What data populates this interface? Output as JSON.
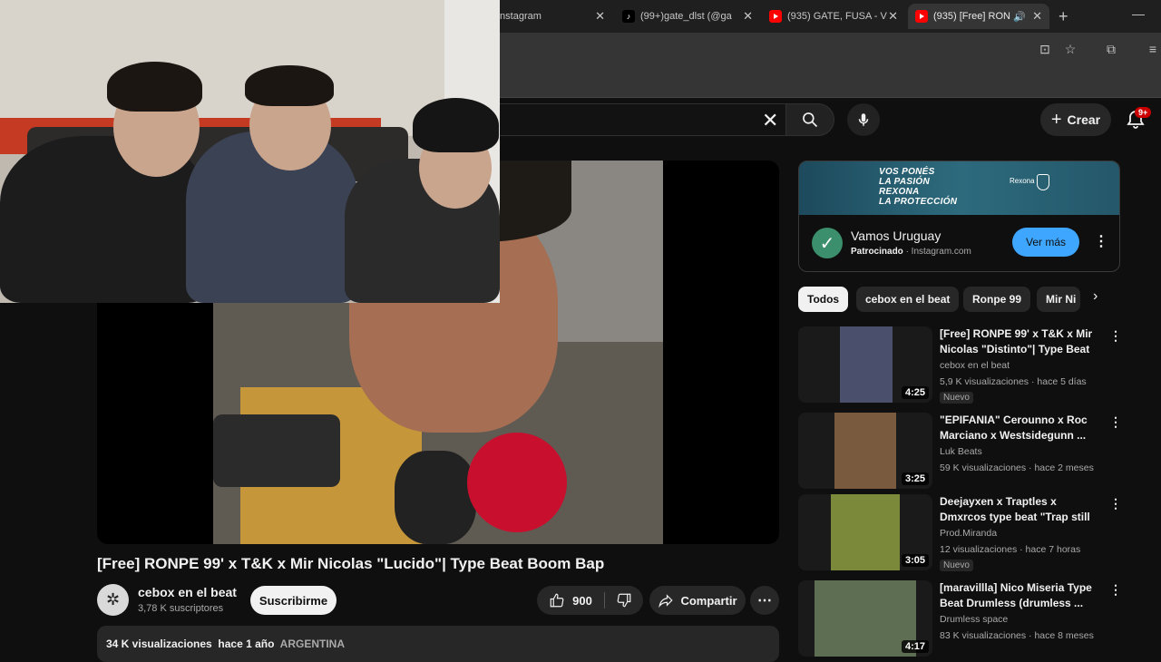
{
  "browser": {
    "tabs": [
      {
        "label": "Instagram"
      },
      {
        "label": "(99+)gate_dlst (@ga"
      },
      {
        "label": "(935) GATE, FUSA - V"
      },
      {
        "label": "(935) [Free] RON"
      }
    ],
    "close_glyph": "✕"
  },
  "header": {
    "create_label": "Crear",
    "notifications_badge": "9+"
  },
  "video": {
    "title": "[Free] RONPE 99' x T&K x Mir Nicolas \"Lucido\"| Type Beat Boom Bap",
    "channel": "cebox en el beat",
    "subscribers": "3,78 K suscriptores",
    "subscribe_label": "Suscribirme",
    "likes": "900",
    "share_label": "Compartir",
    "views": "34 K visualizaciones",
    "age": "hace 1 año",
    "tag": "ARGENTINA"
  },
  "ad": {
    "banner_lines": [
      "VOS PONÉS",
      "LA PASIÓN",
      "REXONA",
      "LA PROTECCIÓN"
    ],
    "banner_brand": "Rexona",
    "title": "Vamos Uruguay",
    "sponsored": "Patrocinado",
    "domain": " · Instagram.com",
    "cta": "Ver más"
  },
  "chips": [
    "Todos",
    "cebox en el beat",
    "Ronpe 99",
    "Mir Ni"
  ],
  "recommendations": [
    {
      "title": "[Free] RONPE 99' x T&K x Mir Nicolas \"Distinto\"| Type Beat ...",
      "channel": "cebox en el beat",
      "meta": "5,9 K visualizaciones · hace 5 días",
      "duration": "4:25",
      "badge": "Nuevo"
    },
    {
      "title": "\"EPIFANIA\" Cerounno x Roc Marciano x Westsidegunn ...",
      "channel": "Luk Beats",
      "meta": "59 K visualizaciones · hace 2 meses",
      "duration": "3:25",
      "badge": ""
    },
    {
      "title": "Deejayxen x Traptles x Dmxrcos type beat \"Trap still lives\" - ...",
      "channel": "Prod.Miranda",
      "meta": "12 visualizaciones · hace 7 horas",
      "duration": "3:05",
      "badge": "Nuevo"
    },
    {
      "title": "[maravillla] Nico Miseria Type Beat Drumless (drumless ...",
      "channel": "Drumless space",
      "meta": "83 K visualizaciones · hace 8 meses",
      "duration": "4:17",
      "badge": ""
    }
  ],
  "colors": {
    "accent": "#3ea6ff",
    "youtube_red": "#ff0000",
    "background": "#0f0f0f"
  }
}
